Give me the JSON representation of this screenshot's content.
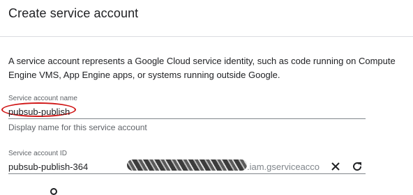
{
  "header": {
    "title": "Create service account"
  },
  "description": "A service account represents a Google Cloud service identity, such as code running on Compute Engine VMS, App Engine apps, or systems running outside Google.",
  "name_field": {
    "label": "Service account name",
    "value": "pubsub-publish",
    "helper": "Display name for this service account"
  },
  "id_field": {
    "label": "Service account ID",
    "value": "pubsub-publish-364",
    "suffix": ".iam.gserviceacco",
    "clear_icon": "close-icon",
    "regenerate_icon": "refresh-icon"
  },
  "colors": {
    "highlight": "#d01515",
    "text": "#202124",
    "secondary": "#5f6368"
  }
}
